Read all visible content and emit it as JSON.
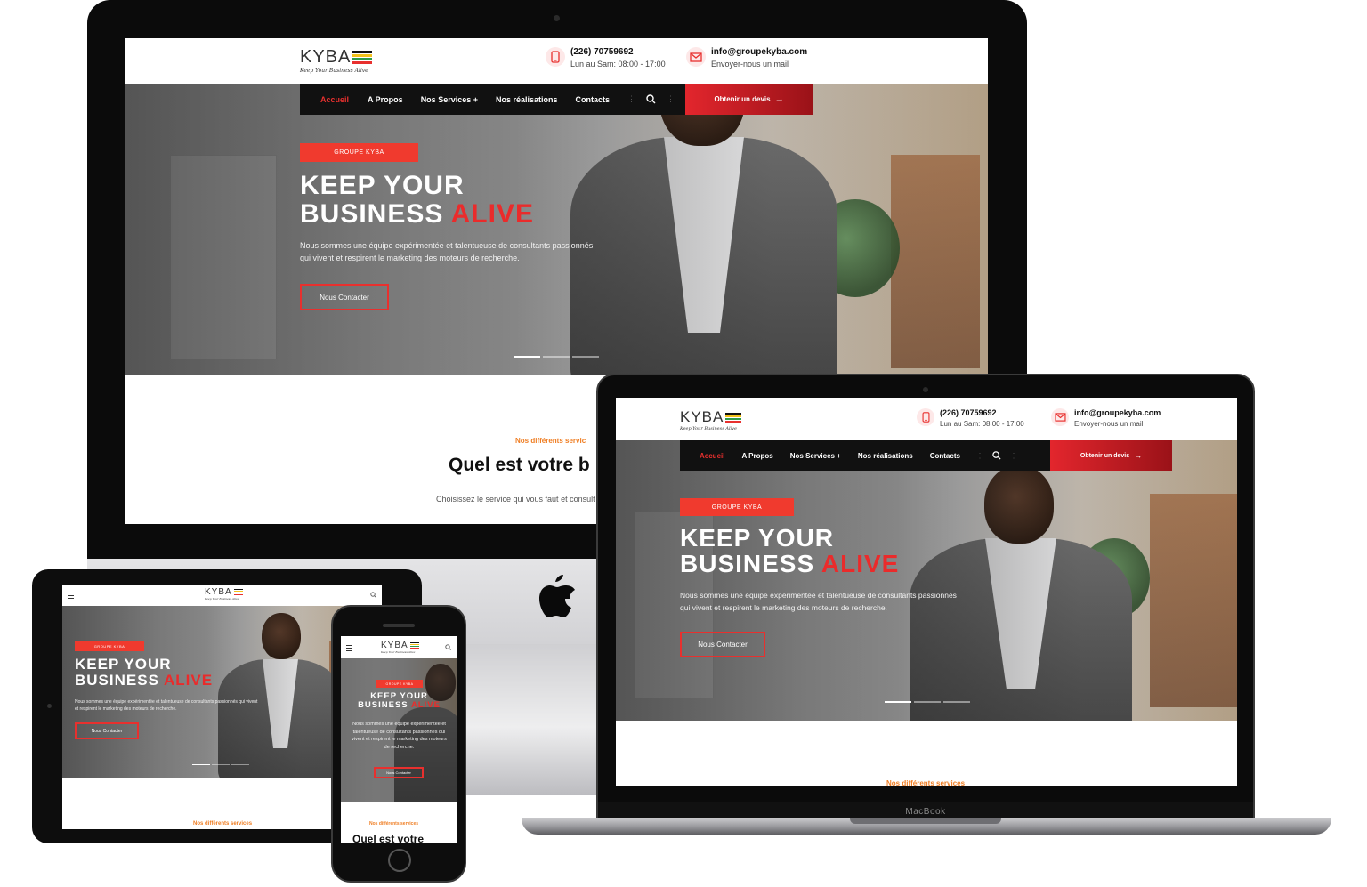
{
  "brand": {
    "logo_word": "KYBA",
    "tagline": "Keep Your Business Alive",
    "flag_colors": [
      "#e8302e",
      "#f4c21b",
      "#2e9b48",
      "#111111"
    ]
  },
  "contact": {
    "phone": "(226) 70759692",
    "hours": "Lun au Sam: 08:00 - 17:00",
    "email": "info@groupekyba.com",
    "email_sub": "Envoyer-nous un mail"
  },
  "nav": {
    "items": [
      {
        "label": "Accueil",
        "active": true
      },
      {
        "label": "A Propos",
        "active": false
      },
      {
        "label": "Nos Services +",
        "active": false
      },
      {
        "label": "Nos réalisations",
        "active": false
      },
      {
        "label": "Contacts",
        "active": false
      }
    ],
    "search_icon": "search-icon",
    "quote_button": "Obtenir un devis",
    "quote_arrow": "→"
  },
  "hero": {
    "badge": "GROUPE KYBA",
    "title_line1": "KEEP YOUR",
    "title_line2_plain": "BUSINESS",
    "title_line2_accent": "ALIVE",
    "description": "Nous sommes une équipe expérimentée et talentueuse de consultants passionnés qui vivent et respirent le marketing des moteurs de recherche.",
    "cta": "Nous Contacter",
    "slides": 3
  },
  "services": {
    "eyebrow": "Nos différents servic",
    "title": "Quel est votre b",
    "subtitle": "Choisissez le service qui vous faut et consult"
  },
  "laptop": {
    "brand_label": "MacBook",
    "eyebrow": "Nos différents services"
  },
  "tablet": {
    "eyebrow": "Nos différents services"
  },
  "phone": {
    "eyebrow": "Nos différents services",
    "section_title": "Quel est votre",
    "description": "Nous sommes une équipe expérimentée et talentueuse de consultants passionnés qui vivent et respirent le marketing des moteurs de recherche."
  },
  "colors": {
    "accent": "#e8302e",
    "orange": "#ef7d22",
    "nav_bg": "#111111"
  },
  "icons": {
    "phone": "phone-icon",
    "mail": "mail-icon",
    "apple": "apple-logo-icon",
    "menu": "hamburger-menu-icon"
  }
}
